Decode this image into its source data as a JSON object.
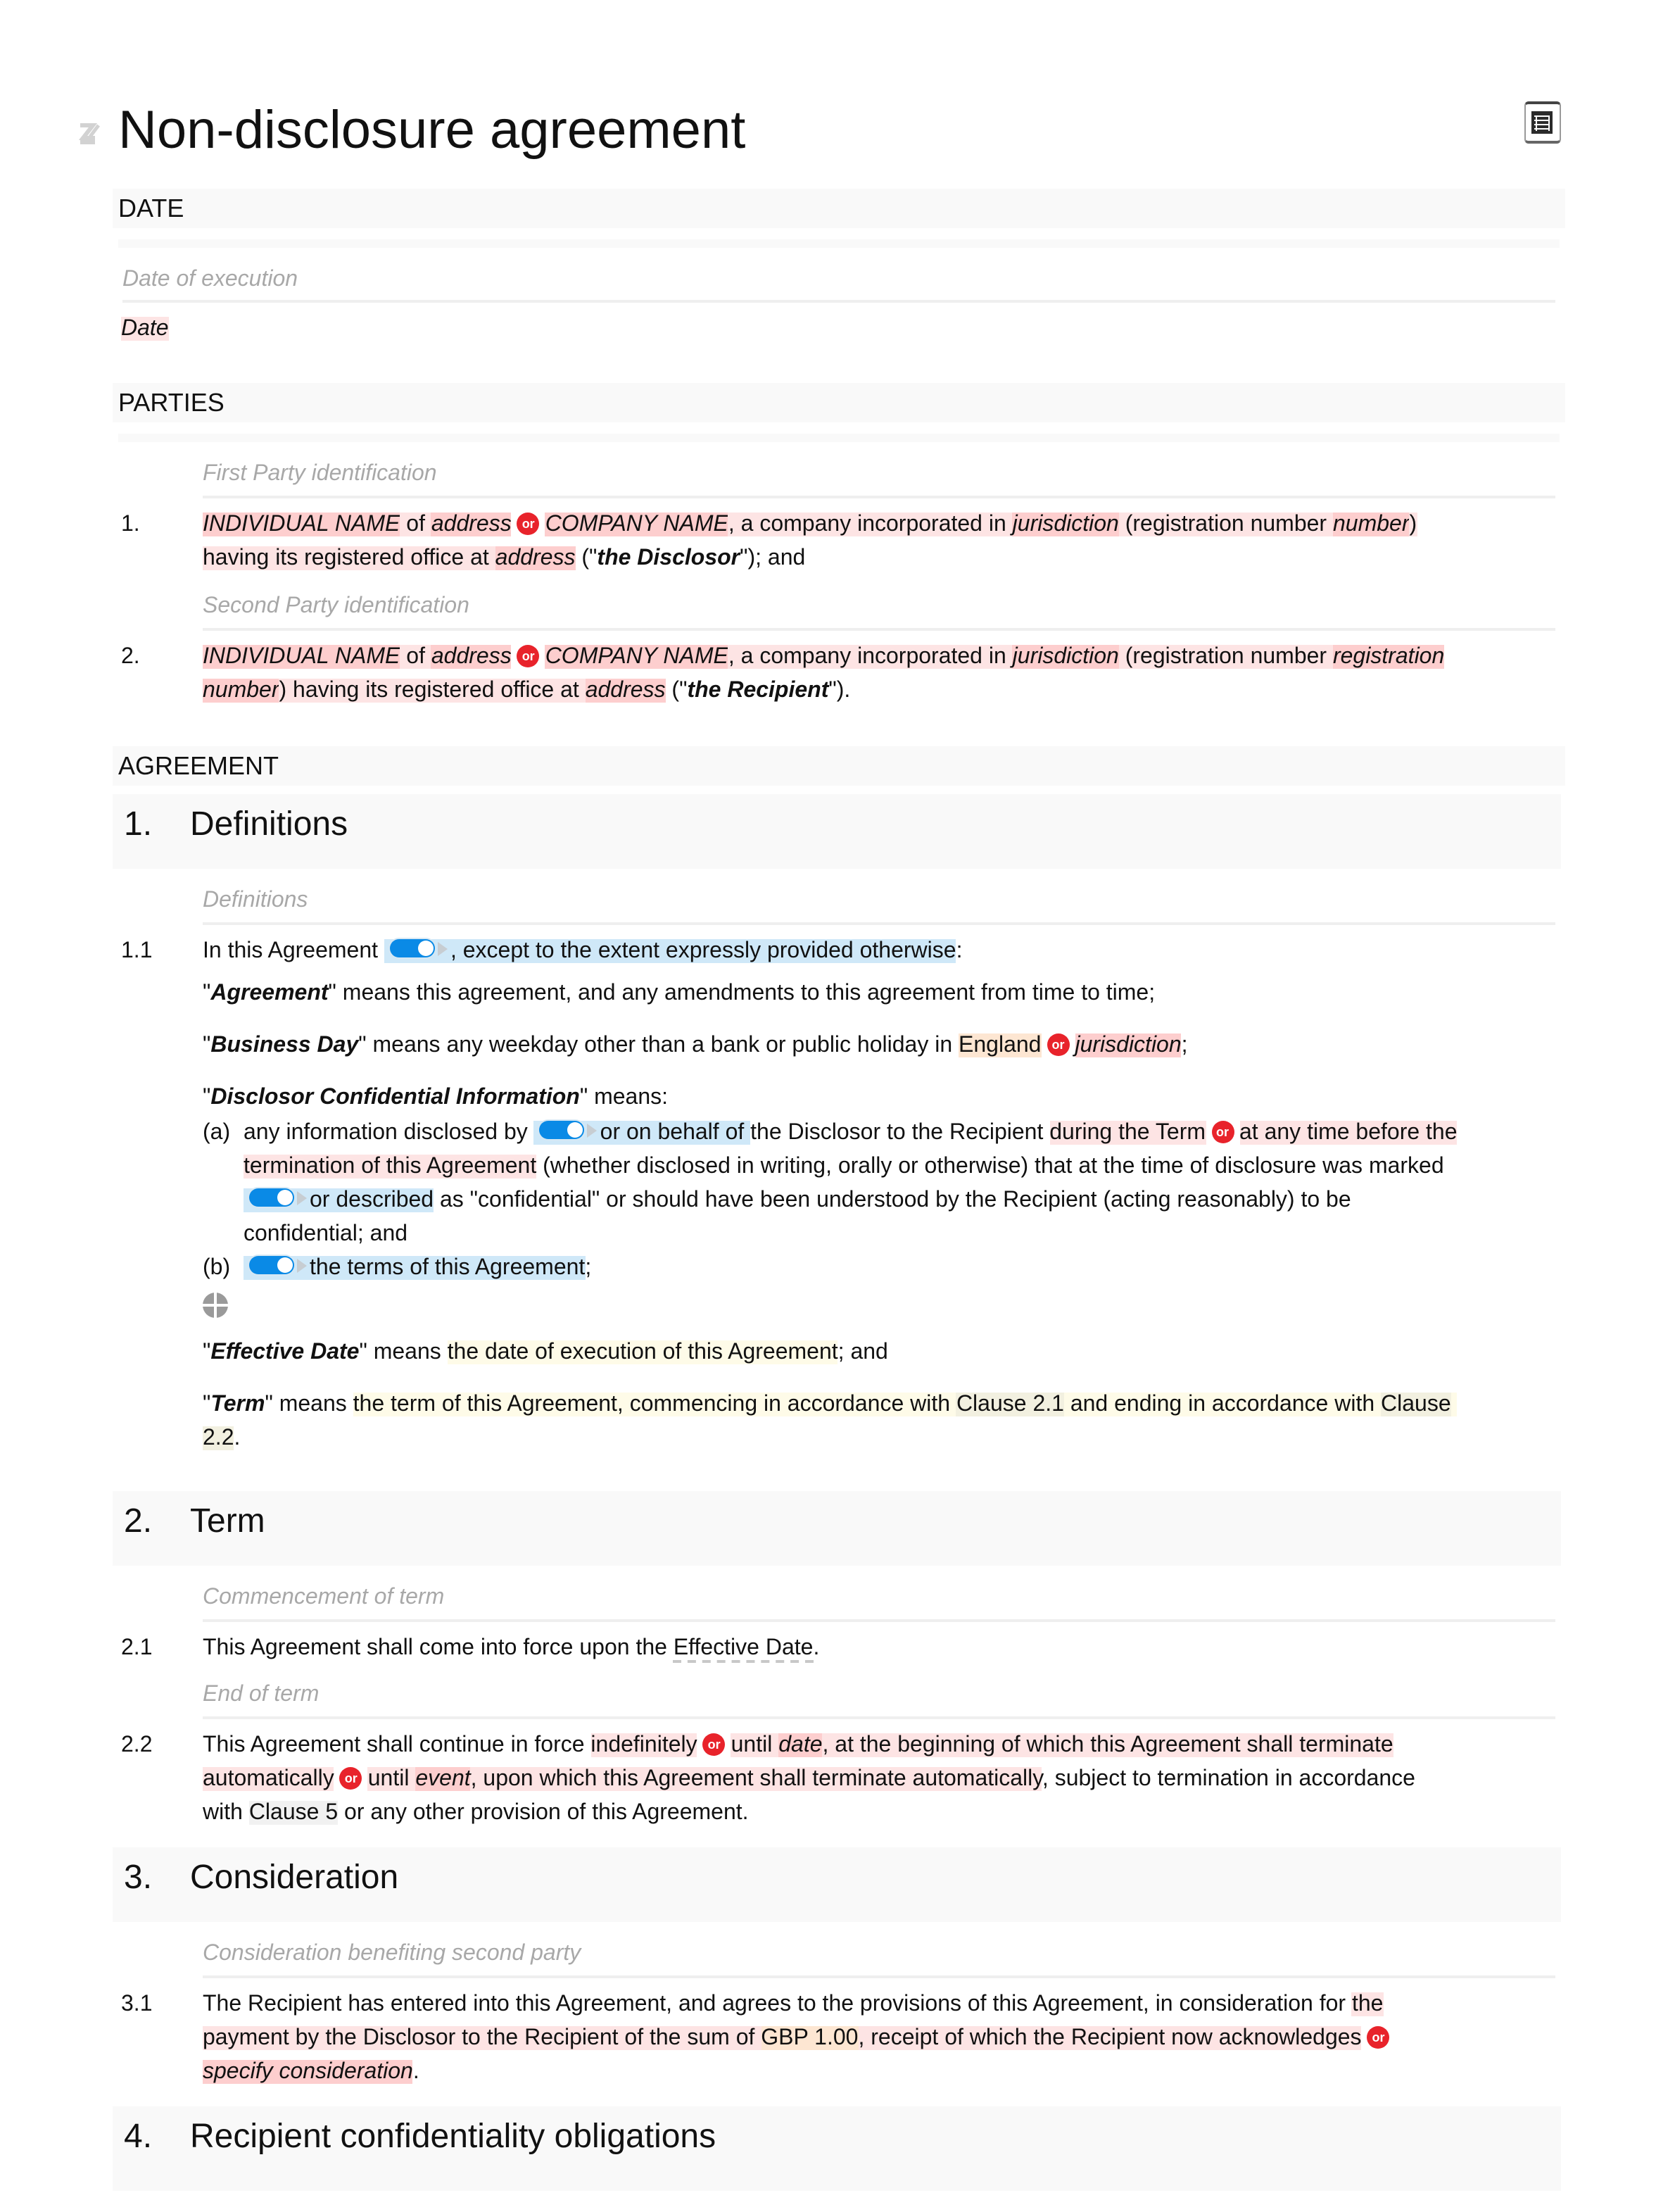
{
  "document": {
    "title": "Non-disclosure agreement",
    "icons": {
      "edit": "edit-icon",
      "toc": "table-of-contents-icon",
      "add": "add-circle-icon"
    }
  },
  "sections": {
    "date": "DATE",
    "parties": "PARTIES",
    "agreement": "AGREEMENT"
  },
  "date_block": {
    "guide": "Date of execution",
    "value": "Date"
  },
  "parties": {
    "first_guide": "First Party identification",
    "second_guide": "Second Party identification",
    "items": [
      {
        "num": "1.",
        "individual_name": "INDIVIDUAL NAME",
        "of": " of ",
        "address": "address",
        "or": "or",
        "company_name": "COMPANY NAME",
        "incorp": ", a company incorporated in ",
        "jurisdiction": "jurisdiction",
        "reg_pre": " (registration number ",
        "reg_num_1": "number",
        "reg_post": ")",
        "line2_pre": "having its registered office at ",
        "address2": "address",
        "defined_pre": " (\"",
        "defined": "the Disclosor",
        "defined_post": "\"); and"
      },
      {
        "num": "2.",
        "individual_name": "INDIVIDUAL NAME",
        "of": " of ",
        "address": "address",
        "or": "or",
        "company_name": "COMPANY NAME",
        "incorp": ", a company incorporated in ",
        "jurisdiction": "jurisdiction",
        "reg_pre": " (registration number ",
        "reg_num_1": "registration",
        "reg_num_2": "number",
        "line2_pre": ") having its registered office at ",
        "address2": "address",
        "defined_pre": " (\"",
        "defined": "the Recipient",
        "defined_post": "\")."
      }
    ]
  },
  "clauses": [
    {
      "num": "1.",
      "title": "Definitions"
    },
    {
      "num": "2.",
      "title": "Term"
    },
    {
      "num": "3.",
      "title": "Consideration"
    },
    {
      "num": "4.",
      "title": "Recipient confidentiality obligations"
    }
  ],
  "definitions": {
    "guide": "Definitions",
    "c11_num": "1.1",
    "c11_pre": "In this Agreement ",
    "c11_opt": ", except to the extent expressly provided otherwise",
    "c11_post": ":",
    "agreement_term": "Agreement",
    "agreement_def": "\" means this agreement, and any amendments to this agreement from time to time;",
    "bd_term": "Business Day",
    "bd_pre": "\" means any weekday other than a bank or public holiday in ",
    "bd_england": "England",
    "bd_or": "or",
    "bd_juris": "jurisdiction",
    "bd_post": ";",
    "dci_term": "Disclosor Confidential Information",
    "dci_post": "\" means:",
    "a_label": "(a)",
    "a_1": "any information disclosed by ",
    "a_opt1": "or on behalf of ",
    "a_2": "the Disclosor to the Recipient ",
    "a_during": "during the Term",
    "a_or": "or",
    "a_anytime": "at any time before the",
    "a_line2_pk": "termination of this Agreement",
    "a_line2": " (whether disclosed in writing, orally or otherwise) that at the time of disclosure was marked",
    "a_opt2": "or described",
    "a_line3": " as \"confidential\" or should have been understood by the Recipient (acting reasonably) to be",
    "a_line4": "confidential; and",
    "b_label": "(b)",
    "b_opt": "the terms of this Agreement",
    "b_post": ";",
    "ed_term": "Effective Date",
    "ed_pre": "\" means ",
    "ed_def": "the date of execution of this Agreement",
    "ed_post": "; and",
    "term_term": "Term",
    "term_pre": "\" means ",
    "term_def1": "the term of this Agreement, commencing in accordance with ",
    "term_clause21": "Clause 2.1",
    "term_def2": " and ending in accordance with ",
    "term_clause": "Clause",
    "term_22": "2.2",
    "term_post": "."
  },
  "term": {
    "guide1": "Commencement of term",
    "c21_num": "2.1",
    "c21_pre": "This Agreement shall come into force upon the ",
    "c21_link": "Effective Date",
    "c21_post": ".",
    "guide2": "End of term",
    "c22_num": "2.2",
    "c22_pre": "This Agreement shall continue in force ",
    "c22_indef": "indefinitely",
    "c22_or1": "or",
    "c22_until1": "until ",
    "c22_date": "date",
    "c22_opt2": ", at the beginning of which this Agreement shall terminate",
    "c22_auto": "automatically",
    "c22_or2": "or",
    "c22_until2": "until ",
    "c22_event": "event",
    "c22_opt3": ", upon which this Agreement shall terminate automatically",
    "c22_post": ", subject to termination in accordance",
    "c22_with": "with ",
    "c22_clause5": "Clause 5",
    "c22_end": " or any other provision of this Agreement."
  },
  "consideration": {
    "guide": "Consideration benefiting second party",
    "c31_num": "3.1",
    "c31_1": "The Recipient has entered into this Agreement, and agrees to the provisions of this Agreement, in consideration for ",
    "c31_the": "the",
    "c31_2": "payment by the Disclosor to the Recipient of the sum of ",
    "c31_amount": "GBP 1.00",
    "c31_3": ", receipt of which the Recipient now acknowledges",
    "c31_or": "or",
    "c31_specify": "specify consideration",
    "c31_end": "."
  }
}
